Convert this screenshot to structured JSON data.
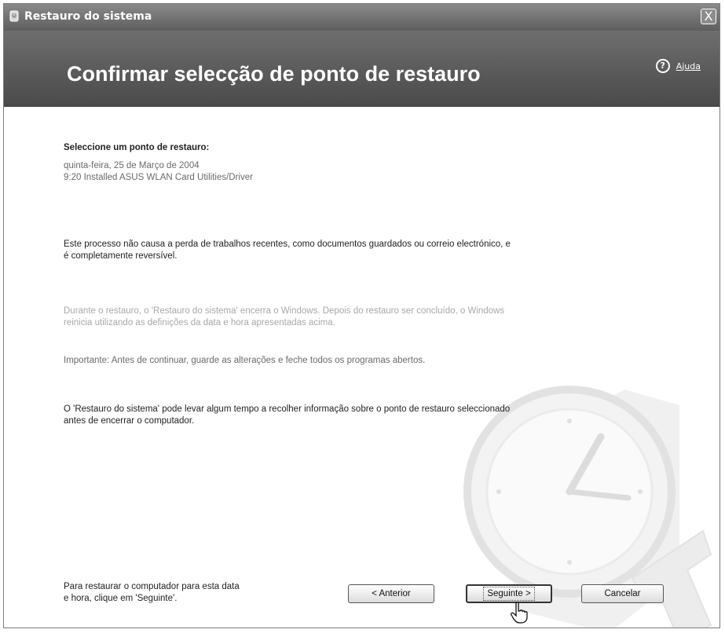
{
  "window": {
    "title": "Restauro do sistema",
    "close_label": "X"
  },
  "header": {
    "heading": "Confirmar selecção de ponto de restauro",
    "help_label": "Ajuda",
    "help_icon_glyph": "?"
  },
  "content": {
    "select_label": "Seleccione um ponto de restauro:",
    "restore_point": {
      "date": "quinta-feira, 25 de Março de 2004",
      "description": "9:20 Installed ASUS WLAN Card Utilities/Driver"
    },
    "info_paragraph": {
      "line1": "Este processo não causa a perda de trabalhos recentes, como documentos guardados ou correio electrónico, e",
      "line2": "é completamente reversível."
    },
    "during_paragraph": {
      "line1": "Durante o restauro, o 'Restauro do sistema' encerra o Windows. Depois do restauro ser concluído, o Windows",
      "line2": "reinicia utilizando as definições da data e hora apresentadas acima."
    },
    "important_text": "Importante: Antes de continuar, guarde as alterações e feche todos os programas abertos.",
    "time_paragraph": {
      "line1": "O 'Restauro do sistema' pode levar algum tempo a recolher informação sobre o ponto de restauro seleccionado",
      "line2": "antes de encerrar o computador."
    }
  },
  "footer": {
    "instruction_line1": "Para restaurar o computador para esta data",
    "instruction_line2": "e hora, clique em 'Seguinte'.",
    "back_label": "< Anterior",
    "next_label": "Seguinte >",
    "cancel_label": "Cancelar"
  },
  "colors": {
    "title_bar": "#6e6e6e",
    "header_band": "#555555",
    "body_bg": "#ffffff",
    "body_text": "#222222",
    "muted_text": "#a8a8a8"
  }
}
